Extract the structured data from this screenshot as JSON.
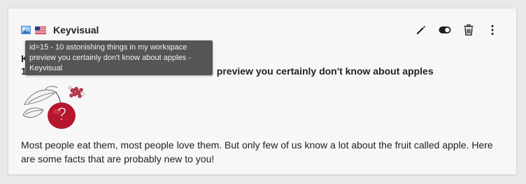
{
  "node": {
    "type_title": "Keyvisual",
    "headline_prefix": "K",
    "headline": "1",
    "headline_visible": "preview you certainly don't know about apples",
    "body": "Most people eat them, most people love them. But only few of us know a lot about the fruit called apple. Here are some facts that are probably new to you!"
  },
  "tooltip": {
    "text": "id=15 - 10 astonishing things in my workspace preview you certainly don't know about apples - Keyvisual"
  },
  "icons": {
    "content_type": "image-icon",
    "language": "us-flag-icon",
    "edit": "pencil-icon",
    "toggle": "toggle-icon",
    "delete": "trash-icon",
    "more": "more-vertical-icon"
  }
}
